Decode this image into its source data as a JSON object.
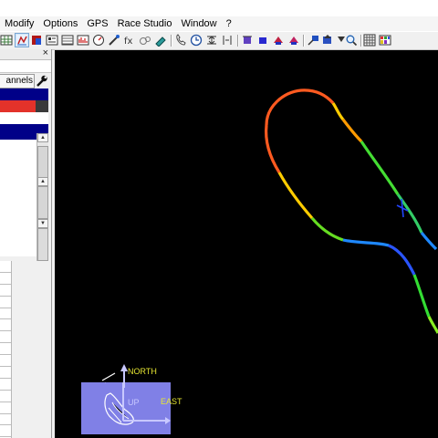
{
  "menu": {
    "items": [
      "Modify",
      "Options",
      "GPS",
      "Race Studio",
      "Window",
      "?"
    ]
  },
  "left_panel": {
    "close_glyph": "×",
    "channels_tab_label": "annels"
  },
  "track_view": {
    "background_color": "#000000",
    "track_colors": [
      "#ff4a20",
      "#ffaa00",
      "#ffff00",
      "#33dd33",
      "#00bbff",
      "#0044ff"
    ],
    "orientation": {
      "north_label": "NORTH",
      "east_label": "EAST",
      "up_label": "UP"
    }
  }
}
